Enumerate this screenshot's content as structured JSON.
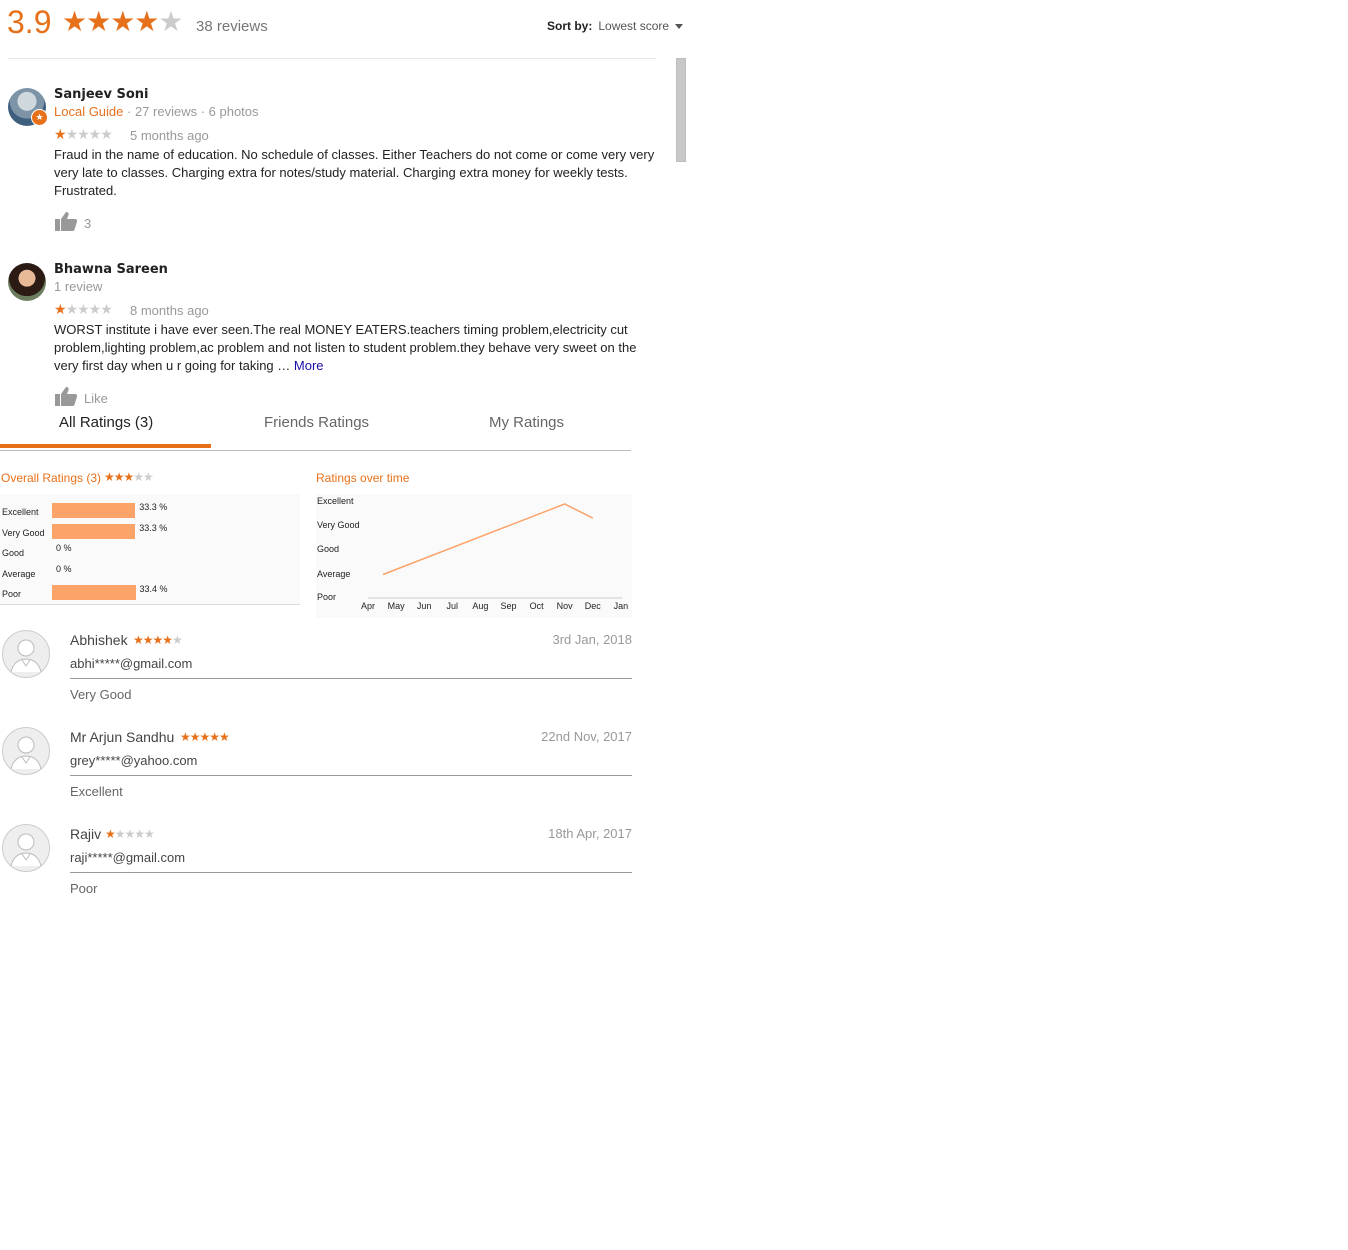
{
  "google": {
    "score": "3.9",
    "stars": {
      "filled": 4,
      "total": 5
    },
    "review_count": "38 reviews",
    "sort_label": "Sort by:",
    "sort_value": "Lowest score"
  },
  "reviews": [
    {
      "name": "Sanjeev Soni",
      "local_guide": "Local Guide",
      "meta": "· 27 reviews · 6 photos",
      "stars_filled": 1,
      "time": "5 months ago",
      "text": "Fraud in the name of education. No schedule of classes. Either Teachers do not come or come very very very late to classes.  Charging extra for notes/study material. Charging extra money for weekly tests. Frustrated.",
      "likes": "3"
    },
    {
      "name": "Bhawna Sareen",
      "meta": "1 review",
      "stars_filled": 1,
      "time": "8 months ago",
      "text": "WORST institute i have ever seen.The real MONEY EATERS.teachers timing problem,electricity cut problem,lighting problem,ac problem and not listen to student problem.they behave very sweet on the very first day when u r going for taking …",
      "more": "More",
      "likes": "Like"
    }
  ],
  "tabs": [
    "All Ratings (3)",
    "Friends Ratings",
    "My Ratings"
  ],
  "overall": {
    "title": "Overall Ratings (3)",
    "stars_filled": 3,
    "star_glyphs": "★★★★★"
  },
  "chart_data": [
    {
      "type": "bar",
      "title": "",
      "categories": [
        "Excellent",
        "Very Good",
        "Good",
        "Average",
        "Poor"
      ],
      "values": [
        33.3,
        33.3,
        0,
        0,
        33.4
      ],
      "labels": [
        "33.3 %",
        "33.3 %",
        "0 %",
        "0 %",
        "33.4 %"
      ],
      "unit": "%"
    },
    {
      "type": "line",
      "title": "Ratings over time",
      "x": [
        "Apr",
        "May",
        "Jun",
        "Jul",
        "Aug",
        "Sep",
        "Oct",
        "Nov",
        "Dec",
        "Jan"
      ],
      "y_categories": [
        "Excellent",
        "Very Good",
        "Good",
        "Average",
        "Poor"
      ],
      "series": [
        {
          "points": [
            {
              "x": "Apr",
              "y": 2
            },
            {
              "x": "Nov",
              "y": 5
            },
            {
              "x": "Dec",
              "y": 4.4
            }
          ]
        }
      ],
      "color": "#fba369"
    }
  ],
  "user_ratings": [
    {
      "name": "Abhishek",
      "stars_filled": 4,
      "date": "3rd Jan, 2018",
      "email": "abhi*****@gmail.com",
      "rating_text": "Very Good"
    },
    {
      "name": "Mr Arjun Sandhu",
      "stars_filled": 5,
      "date": "22nd Nov, 2017",
      "email": "grey*****@yahoo.com",
      "rating_text": "Excellent"
    },
    {
      "name": "Rajiv",
      "stars_filled": 1,
      "date": "18th Apr, 2017",
      "email": "raji*****@gmail.com",
      "rating_text": "Poor"
    }
  ],
  "colors": {
    "accent": "#e7711b",
    "bar": "#fba369",
    "link": "#1a0dab"
  }
}
